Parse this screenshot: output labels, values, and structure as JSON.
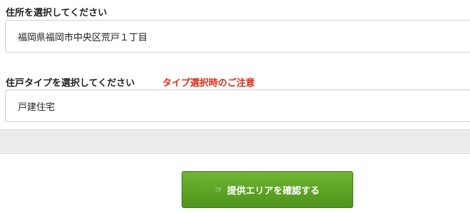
{
  "address": {
    "label": "住所を選択してください",
    "value": "福岡県福岡市中央区荒戸１丁目"
  },
  "housing_type": {
    "label": "住戸タイプを選択してください",
    "notice": "タイプ選択時のご注意",
    "value": "戸建住宅"
  },
  "confirm_button": {
    "icon": "pointing-hand-icon",
    "label": "提供エリアを確認する"
  },
  "colors": {
    "notice": "#e02b12",
    "button": "#5ea126"
  }
}
